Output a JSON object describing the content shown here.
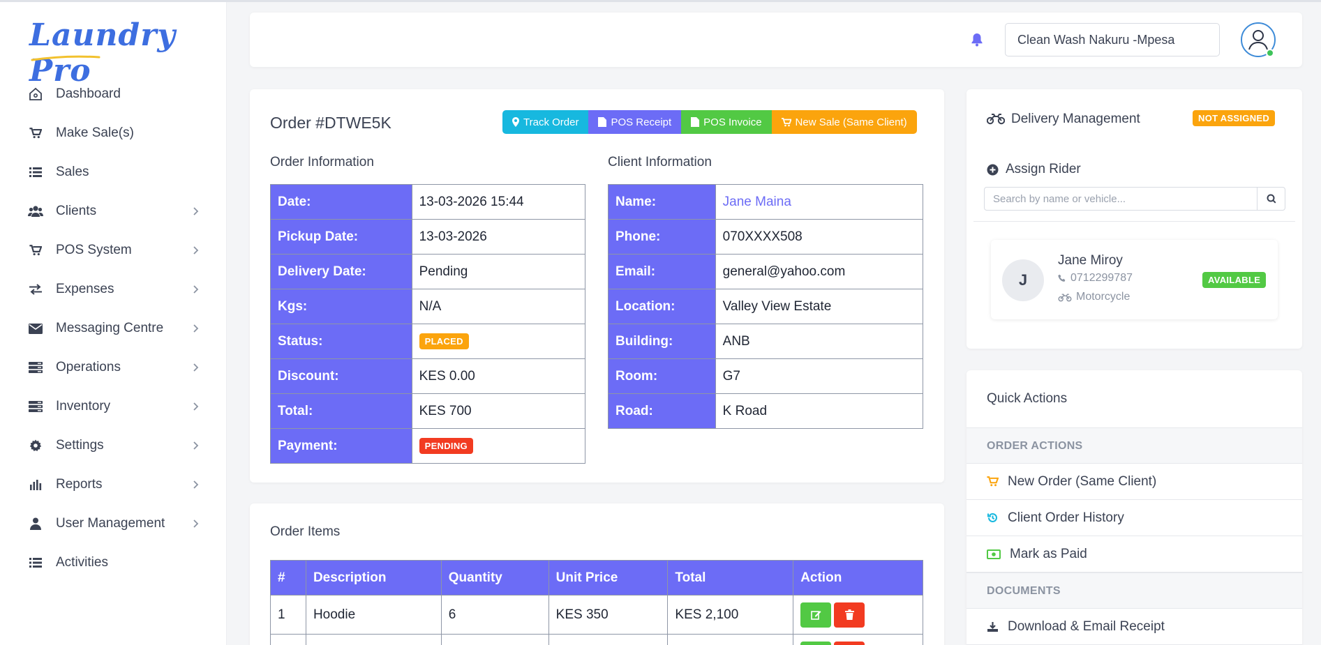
{
  "app": {
    "logo_text": "Laundry Pro"
  },
  "sidebar": {
    "items": [
      {
        "label": "Dashboard",
        "icon": "home-icon",
        "chevron": false
      },
      {
        "label": "Make Sale(s)",
        "icon": "cart-icon",
        "chevron": false
      },
      {
        "label": "Sales",
        "icon": "list-icon",
        "chevron": false
      },
      {
        "label": "Clients",
        "icon": "users-icon",
        "chevron": true
      },
      {
        "label": "POS System",
        "icon": "cart-icon",
        "chevron": true
      },
      {
        "label": "Expenses",
        "icon": "exchange-icon",
        "chevron": true
      },
      {
        "label": "Messaging Centre",
        "icon": "envelope-icon",
        "chevron": true
      },
      {
        "label": "Operations",
        "icon": "server-icon",
        "chevron": true
      },
      {
        "label": "Inventory",
        "icon": "server-icon",
        "chevron": true
      },
      {
        "label": "Settings",
        "icon": "gear-icon",
        "chevron": true
      },
      {
        "label": "Reports",
        "icon": "bar-chart-icon",
        "chevron": true
      },
      {
        "label": "User Management",
        "icon": "user-icon",
        "chevron": true
      },
      {
        "label": "Activities",
        "icon": "list-icon",
        "chevron": false
      }
    ]
  },
  "topbar": {
    "branch": "Clean Wash Nakuru -Mpesa"
  },
  "order": {
    "title": "Order #DTWE5K",
    "buttons": {
      "track": "Track Order",
      "receipt": "POS Receipt",
      "invoice": "POS Invoice",
      "new_sale": "New Sale (Same Client)"
    },
    "order_info_heading": "Order Information",
    "client_info_heading": "Client Information",
    "order_info": {
      "date_label": "Date:",
      "date": "13-03-2026 15:44",
      "pickup_label": "Pickup Date:",
      "pickup": "13-03-2026",
      "delivery_label": "Delivery Date:",
      "delivery": "Pending",
      "kgs_label": "Kgs:",
      "kgs": "N/A",
      "status_label": "Status:",
      "status": "PLACED",
      "discount_label": "Discount:",
      "discount": "KES 0.00",
      "total_label": "Total:",
      "total": "KES 700",
      "payment_label": "Payment:",
      "payment": "PENDING"
    },
    "client_info": {
      "name_label": "Name:",
      "name": "Jane Maina",
      "phone_label": "Phone:",
      "phone": "070XXXX508",
      "email_label": "Email:",
      "email": "general@yahoo.com",
      "location_label": "Location:",
      "location": "Valley View Estate",
      "building_label": "Building:",
      "building": "ANB",
      "room_label": "Room:",
      "room": "G7",
      "road_label": "Road:",
      "road": "K Road"
    }
  },
  "items": {
    "heading": "Order Items",
    "columns": [
      "#",
      "Description",
      "Quantity",
      "Unit Price",
      "Total",
      "Action"
    ],
    "rows": [
      {
        "num": "1",
        "description": "Hoodie",
        "quantity": "6",
        "unit_price": "KES 350",
        "total": "KES 2,100"
      }
    ]
  },
  "delivery": {
    "title": "Delivery Management",
    "status": "NOT ASSIGNED",
    "assign_label": "Assign Rider",
    "search_placeholder": "Search by name or vehicle...",
    "rider": {
      "initial": "J",
      "name": "Jane Miroy",
      "phone": "0712299787",
      "vehicle": "Motorcycle",
      "status": "AVAILABLE"
    }
  },
  "quick_actions": {
    "title": "Quick Actions",
    "order_actions_heading": "ORDER ACTIONS",
    "new_order": "New Order (Same Client)",
    "history": "Client Order History",
    "mark_paid": "Mark as Paid",
    "documents_heading": "DOCUMENTS",
    "download_receipt": "Download & Email Receipt"
  },
  "colors": {
    "primary": "#6c6cf6",
    "info": "#17b8df",
    "success": "#52c944",
    "warning": "#fba40d",
    "danger": "#f23b21"
  }
}
